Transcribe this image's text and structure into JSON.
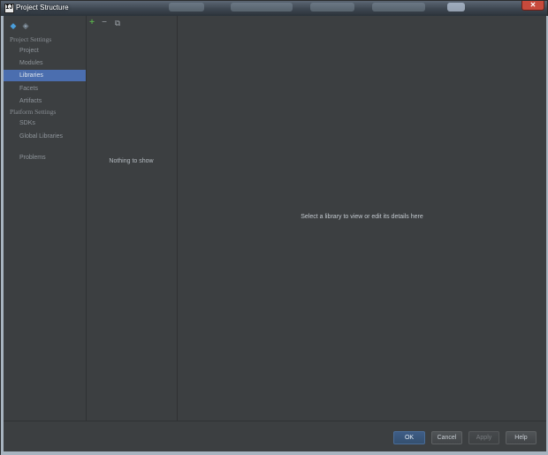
{
  "window": {
    "title": "Project Structure",
    "app_icon_glyph": "IJ",
    "close_glyph": "✕"
  },
  "sidebar": {
    "nav_back_icon": "back-arrow-icon",
    "nav_forward_icon": "forward-arrow-icon",
    "sections": [
      {
        "title": "Project Settings"
      },
      {
        "title": "Platform Settings"
      }
    ],
    "items": [
      {
        "label": "Project",
        "selected": false
      },
      {
        "label": "Modules",
        "selected": false
      },
      {
        "label": "Libraries",
        "selected": true
      },
      {
        "label": "Facets",
        "selected": false
      },
      {
        "label": "Artifacts",
        "selected": false
      },
      {
        "label": "SDKs",
        "selected": false
      },
      {
        "label": "Global Libraries",
        "selected": false
      },
      {
        "label": "Problems",
        "selected": false
      }
    ]
  },
  "list_panel": {
    "toolbar": {
      "add_glyph": "+",
      "remove_glyph": "−",
      "copy_glyph": "⧉"
    },
    "empty_text": "Nothing to show"
  },
  "detail_panel": {
    "empty_text": "Select a library to view or edit its details here"
  },
  "buttons": {
    "ok": "OK",
    "cancel": "Cancel",
    "apply": "Apply",
    "help": "Help"
  },
  "colors": {
    "background": "#3c3f41",
    "selection": "#4b6eaf",
    "add_icon": "#57a64a",
    "close_button": "#c74a3c"
  }
}
